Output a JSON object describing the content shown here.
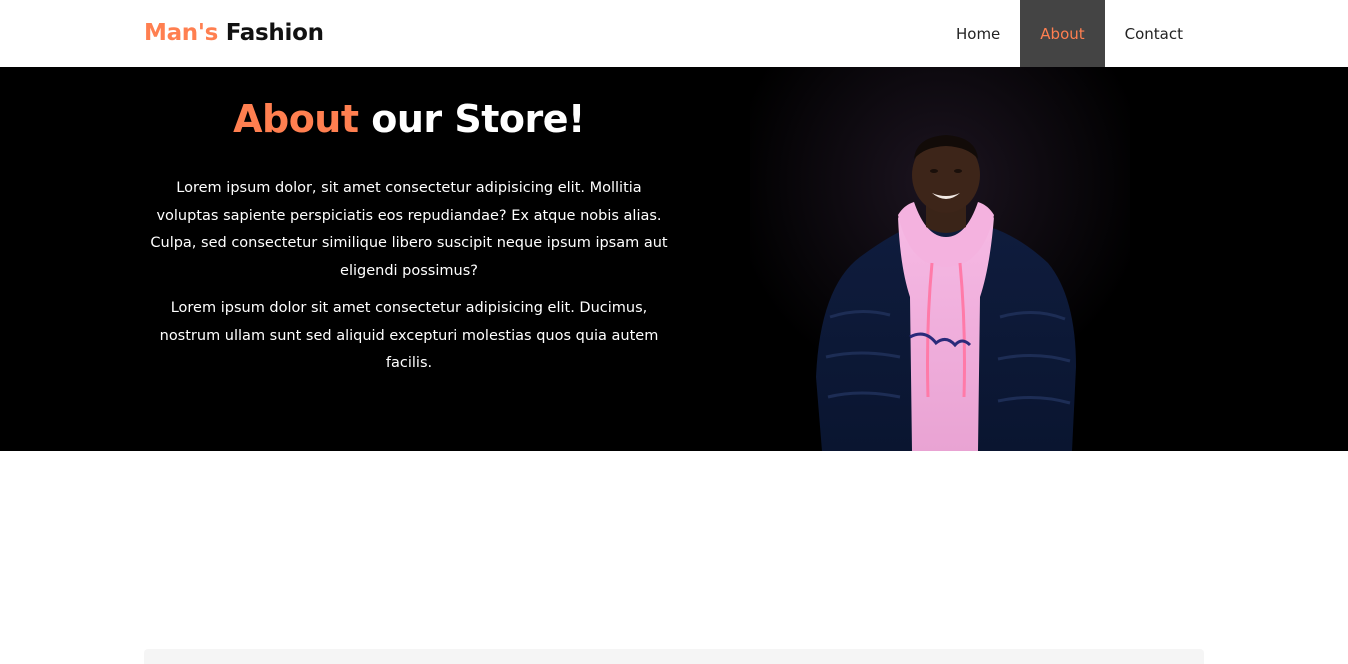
{
  "brand": {
    "accent": "Man's",
    "rest": "Fashion"
  },
  "nav": [
    {
      "label": "Home"
    },
    {
      "label": "About"
    },
    {
      "label": "Contact"
    }
  ],
  "hero": {
    "title_accent": "About",
    "title_rest": "our Store!",
    "paragraphs": [
      "Lorem ipsum dolor, sit amet consectetur adipisicing elit. Mollitia voluptas sapiente perspiciatis eos repudiandae? Ex atque nobis alias. Culpa, sed consectetur similique libero suscipit neque ipsum ipsam aut eligendi possimus?",
      "Lorem ipsum dolor sit amet consectetur adipisicing elit. Ducimus, nostrum ullam sunt sed aliquid excepturi molestias quos quia autem facilis."
    ]
  },
  "colors": {
    "accent": "#ff7f50",
    "nav_active_bg": "#444444",
    "hero_bg": "#000000"
  }
}
